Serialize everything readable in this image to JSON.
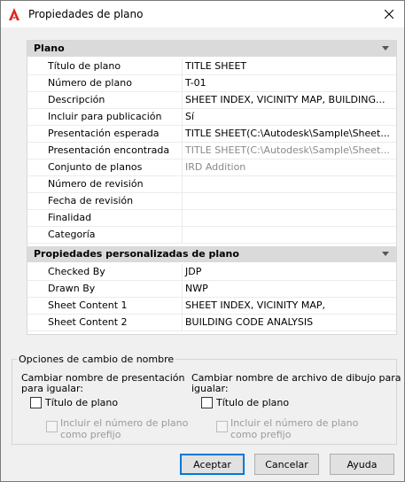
{
  "window": {
    "title": "Propiedades de plano"
  },
  "sections": [
    {
      "title": "Plano",
      "rows": [
        {
          "label": "Título de plano",
          "value": "TITLE SHEET"
        },
        {
          "label": "Número de plano",
          "value": "T-01"
        },
        {
          "label": "Descripción",
          "value": "SHEET INDEX,  VICINITY MAP,  BUILDING..."
        },
        {
          "label": "Incluir para publicación",
          "value": "Sí"
        },
        {
          "label": "Presentación esperada",
          "value": "TITLE  SHEET(C:\\Autodesk\\Sample\\Sheet..."
        },
        {
          "label": "Presentación encontrada",
          "value": "TITLE  SHEET(C:\\Autodesk\\Sample\\Sheet...",
          "disabled": true
        },
        {
          "label": "Conjunto de planos",
          "value": "IRD Addition",
          "disabled": true
        },
        {
          "label": "Número de revisión",
          "value": ""
        },
        {
          "label": "Fecha de revisión",
          "value": ""
        },
        {
          "label": "Finalidad",
          "value": ""
        },
        {
          "label": "Categoría",
          "value": ""
        }
      ]
    },
    {
      "title": "Propiedades personalizadas de plano",
      "rows": [
        {
          "label": "Checked By",
          "value": "JDP"
        },
        {
          "label": "Drawn By",
          "value": "NWP"
        },
        {
          "label": "Sheet Content 1",
          "value": "SHEET INDEX, VICINITY MAP,"
        },
        {
          "label": "Sheet Content 2",
          "value": "BUILDING CODE ANALYSIS"
        }
      ]
    }
  ],
  "rename": {
    "legend": "Opciones de cambio de nombre",
    "layout_heading_1": "Cambiar nombre de presentación",
    "layout_heading_2": "para igualar:",
    "layout_checkbox": "Título de plano",
    "layout_prefix_1": "Incluir el número de plano",
    "layout_prefix_2": "como prefijo",
    "file_heading_1": "Cambiar nombre de archivo de dibujo para",
    "file_heading_2": "igualar:",
    "file_checkbox": "Título de plano",
    "file_prefix_1": "Incluir el número de plano",
    "file_prefix_2": "como prefijo"
  },
  "buttons": {
    "accept": "Aceptar",
    "cancel": "Cancelar",
    "help": "Ayuda"
  },
  "icons": {
    "app": "autocad-logo-icon",
    "close": "close-icon"
  },
  "colors": {
    "accent": "#0078d7",
    "app_icon": "#e0221b"
  }
}
